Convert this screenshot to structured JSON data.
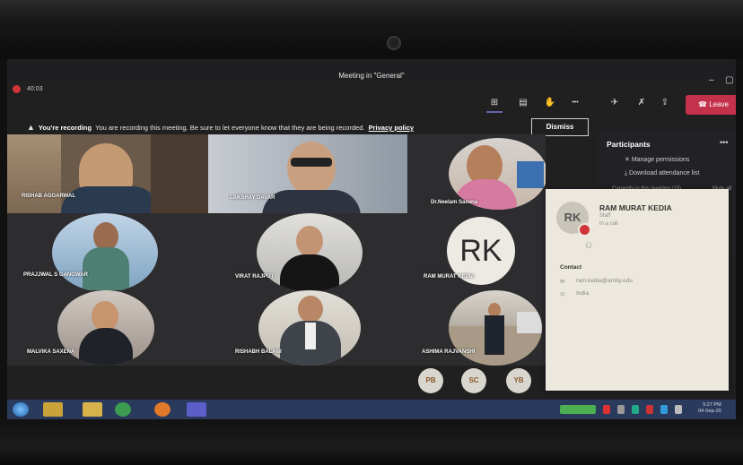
{
  "window": {
    "title": "Meeting in \"General\"",
    "timer": "40:03",
    "minimize": "–",
    "maximize": "▢"
  },
  "toolbar": {
    "icons": [
      "participants-grid-icon",
      "chat-icon",
      "raise-hand-icon",
      "more-icon",
      "camera-off-icon",
      "mic-off-icon",
      "share-icon",
      "leave-phone-icon"
    ],
    "glyphs": {
      "grid": "⊞",
      "chat": "▤",
      "hand": "✋",
      "more": "•••",
      "camera": "✈",
      "mic": "✗",
      "share": "⇪",
      "phone": "☎"
    },
    "leave_label": "Leave"
  },
  "banner": {
    "bold": "You're recording",
    "text": "You are recording this meeting. Be sure to let everyone know that they are being recorded.",
    "link": "Privacy policy",
    "dismiss": "Dismiss"
  },
  "tiles": [
    {
      "name": "RISHAB AGGARWAL",
      "style": "photo"
    },
    {
      "name": "LAKSHAY DAVAR",
      "style": "photo"
    },
    {
      "name": "Dr.Neelam Saxena",
      "style": "circle"
    },
    {
      "name": "PRAJJWAL S GANGWAR",
      "style": "circle"
    },
    {
      "name": "VIRAT RAJPUT",
      "style": "circle"
    },
    {
      "name": "RAM MURAT KEDIA",
      "style": "initials",
      "initials": "RK"
    },
    {
      "name": "MALVIKA SAXENA",
      "style": "circle"
    },
    {
      "name": "RISHABH BALANI",
      "style": "circle"
    },
    {
      "name": "ASHIMA RAJVANSHI",
      "style": "circle"
    }
  ],
  "overflow_avatars": [
    "PB",
    "SC",
    "YB"
  ],
  "participants": {
    "title": "Participants",
    "more": "•••",
    "manage": "Manage permissions",
    "download": "Download attendance list",
    "currently": "Currently in this meeting (15)",
    "mute_all": "Mute all"
  },
  "card": {
    "initials": "RK",
    "name": "RAM MURAT KEDIA",
    "role": "Staff",
    "status": "In a call",
    "contact_label": "Contact",
    "email": "ram.kedia@amity.edu",
    "location": "India"
  },
  "taskbar": {
    "time": "5:27 PM",
    "date": "04-Sep-20"
  },
  "colors": {
    "leave": "#c4314b",
    "recording": "#d13438",
    "taskbar": "#2a3a5c"
  }
}
